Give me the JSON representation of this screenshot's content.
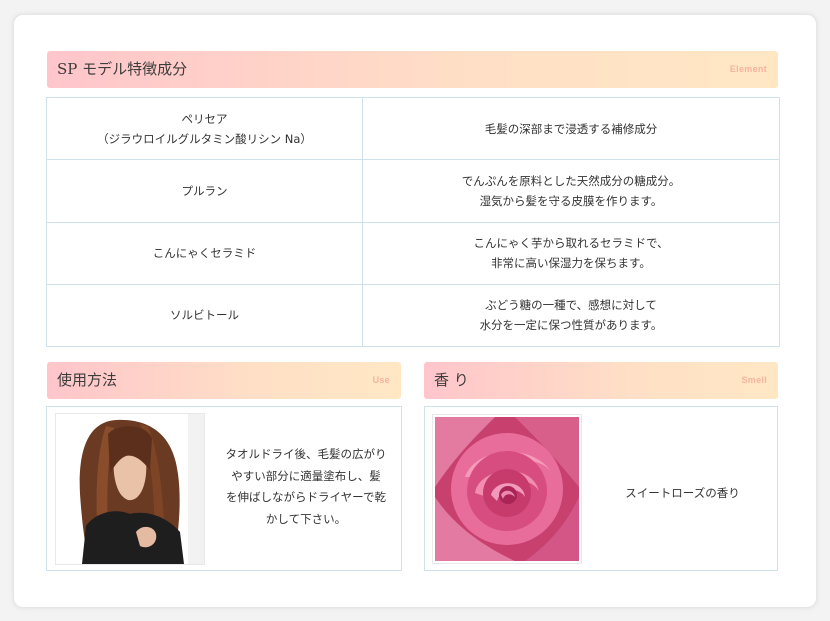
{
  "element_section": {
    "title": "SP モデル特徴成分",
    "tag": "Element",
    "rows": [
      {
        "name": [
          "ペリセア",
          "（ジラウロイルグルタミン酸リシン Na）"
        ],
        "desc": [
          "毛髪の深部まで浸透する補修成分"
        ]
      },
      {
        "name": [
          "プルラン"
        ],
        "desc": [
          "でんぷんを原料とした天然成分の糖成分。",
          "湿気から髪を守る皮膜を作ります。"
        ]
      },
      {
        "name": [
          "こんにゃくセラミド"
        ],
        "desc": [
          "こんにゃく芋から取れるセラミドで、",
          "非常に高い保湿力を保ちます。"
        ]
      },
      {
        "name": [
          "ソルビトール"
        ],
        "desc": [
          "ぶどう糖の一種で、感想に対して",
          "水分を一定に保つ性質があります。"
        ]
      }
    ]
  },
  "use_section": {
    "title": "使用方法",
    "tag": "Use",
    "text": [
      "タオルドライ後、毛髪の広がり",
      "やすい部分に適量塗布し、髪",
      "を伸ばしながらドライヤーで乾",
      "かして下さい。"
    ]
  },
  "smell_section": {
    "title": "香 り",
    "tag": "Smell",
    "text": "スイートローズの香り"
  },
  "colors": {
    "header_gradient_start": "#ffc5cb",
    "header_gradient_end": "#ffe7c4",
    "tag_color": "#f6b3a2",
    "table_border": "#cfe2ea"
  }
}
